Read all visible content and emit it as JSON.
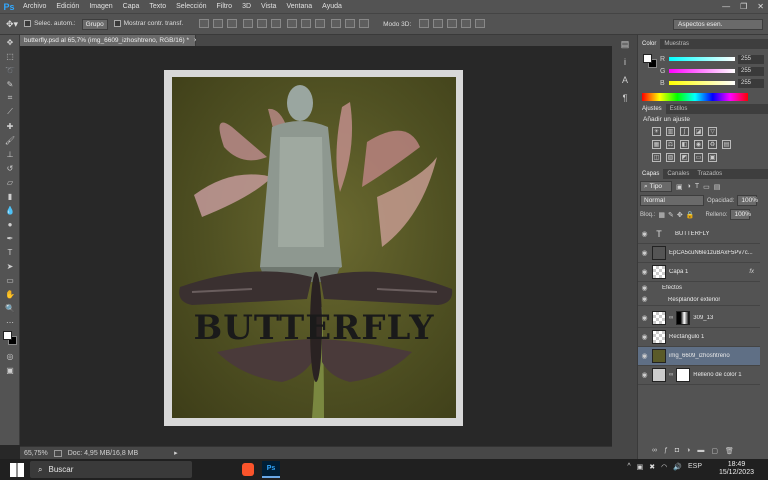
{
  "app": {
    "logo": "Ps"
  },
  "menu": [
    "Archivo",
    "Edición",
    "Imagen",
    "Capa",
    "Texto",
    "Selección",
    "Filtro",
    "3D",
    "Vista",
    "Ventana",
    "Ayuda"
  ],
  "window_controls": {
    "minimize": "—",
    "maximize": "❐",
    "close": "✕"
  },
  "options_bar": {
    "auto_select_label": "Selec. autom.:",
    "auto_select_value": "Grupo",
    "transform_label": "Mostrar contr. transf.",
    "mode3d_label": "Modo 3D:",
    "workspace": "Aspectos esen."
  },
  "document": {
    "tab_title": "butterfly.psd al 65,7% (img_6609_izhoshtreno, RGB/16) *",
    "tab_close": "×",
    "artwork_text": "BUTTERFLY"
  },
  "status": {
    "zoom": "65,75%",
    "doc_info": "Doc: 4,95 MB/16,8 MB"
  },
  "color_panel": {
    "tabs": [
      "Color",
      "Muestras"
    ],
    "channels": [
      {
        "label": "R",
        "value": "255"
      },
      {
        "label": "G",
        "value": "255"
      },
      {
        "label": "B",
        "value": "255"
      }
    ]
  },
  "adjustments_panel": {
    "tabs": [
      "Ajustes",
      "Estilos"
    ],
    "heading": "Añadir un ajuste"
  },
  "layers_panel": {
    "tabs": [
      "Capas",
      "Canales",
      "Trazados"
    ],
    "filter": "Tipo",
    "blend_mode": "Normal",
    "opacity_label": "Opacidad:",
    "opacity_value": "100%",
    "lock_label": "Bloq.:",
    "fill_label": "Relleno:",
    "fill_value": "100%",
    "layers": [
      {
        "name": "BUTTERFLY"
      },
      {
        "name": "EpCA5cuN6le1zuBAxF5Pv7c..."
      },
      {
        "name": "Capa 1",
        "fx": "fx"
      },
      {
        "name": "Efectos"
      },
      {
        "name": "Resplandor exterior"
      },
      {
        "name": "309_13"
      },
      {
        "name": "Rectángulo 1"
      },
      {
        "name": "img_6609_izhoshtreno"
      },
      {
        "name": "Relleno de color 1"
      }
    ]
  },
  "taskbar": {
    "search_placeholder": "Buscar",
    "language": "ESP",
    "time": "18:49",
    "date": "15/12/2023"
  }
}
